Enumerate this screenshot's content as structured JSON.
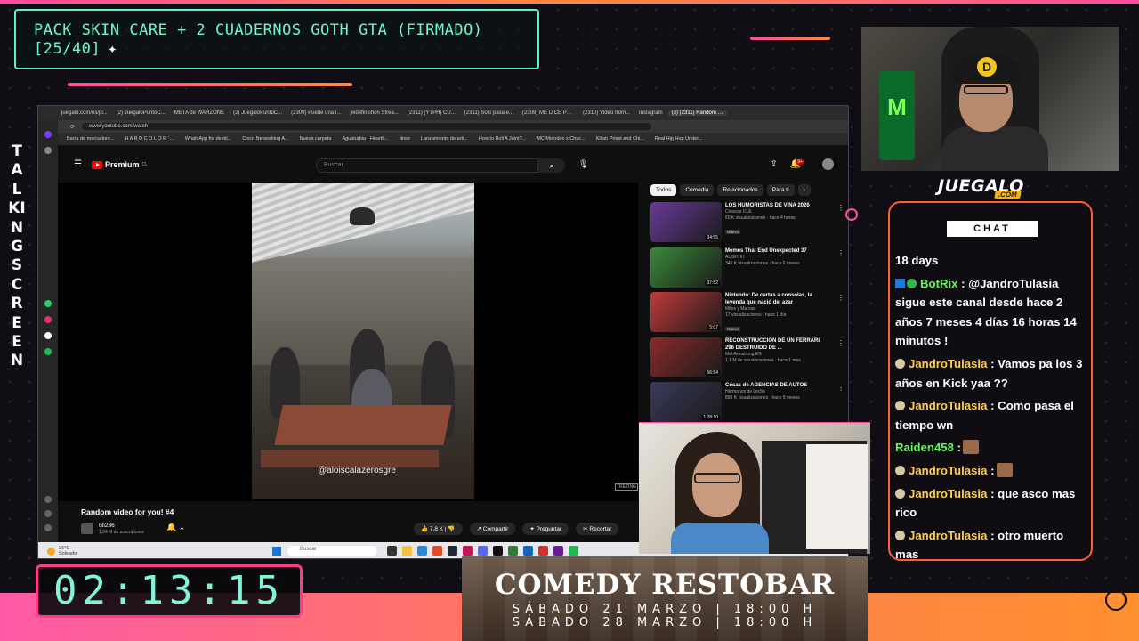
{
  "overlay": {
    "goal_text": "PACK SKIN CARE + 2 CUADERNOS GOTH GTA (FIRMADO)",
    "goal_progress": "[25/40]",
    "goal_spark": "✦",
    "side_text": "TALKING SCREEN",
    "timer": "02:13:15",
    "brand": "JUEGALO",
    "brand_sub": ".COM"
  },
  "browser": {
    "tabs": [
      "juegalo.com/es/pl...",
      "(2) JuegaloPuntoC...",
      "META de WARZONE",
      "(2) JuegaloPuntoC...",
      "(2309) Puede una I...",
      "jeidefinichon Strea...",
      "(2311) (YTPH) CU...",
      "(2311) Solo pasa e...",
      "(2309) ME DICE PR...",
      "(2310) Video from...",
      "Instagram",
      "(3) (2311) Random video"
    ],
    "active_tab_index": 11,
    "url": "www.youtube.com/watch",
    "bookmarks": [
      "Barra de marcadore...",
      "H A R D C O L O R ' ...",
      "WhatsApp for deskt...",
      "Cisco Networking A...",
      "Nueva carpeta",
      "Aguaturbia - Heartb...",
      "drew",
      "Lanzamiento de arti...",
      "How to Roll A Joint?...",
      "MC Melodee x Chuc...",
      "Killah Priest and Chi...",
      "Real Hip Hop Under..."
    ]
  },
  "youtube": {
    "logo": "Premium",
    "logo_region": "CL",
    "search_placeholder": "Buscar",
    "notifications_badge": "9+",
    "video_watermark": "@aloiscalazerosgre",
    "video_tag": "TREZING",
    "video_title": "Random video for you! #4",
    "channel_name": "t3i236",
    "channel_subs": "1,04 M de suscriptores",
    "likes": "7,8 K",
    "share": "Compartir",
    "ask": "Preguntar",
    "clip": "Recortar",
    "chips": [
      "Todos",
      "Comedia",
      "Relacionados",
      "Para ti"
    ],
    "recommendations": [
      {
        "title": "LOS HUMORISTAS DE VIÑA 2026",
        "channel": "Crescas OLE",
        "meta": "50 K visualizaciones · hace 4 horas",
        "badge": "Nuevo",
        "duration": "34:55",
        "color": "#6a3a9a"
      },
      {
        "title": "Memes That End Unexpected 37",
        "channel": "AUGHHH",
        "meta": "340 K visualizaciones · hace 6 meses",
        "badge": "",
        "duration": "37:52",
        "color": "#3a8a3a"
      },
      {
        "title": "Nintendo: De cartas a consolas, la leyenda que nació del azar",
        "channel": "Mitos y Marcas",
        "meta": "17 visualizaciones · hace 1 día",
        "badge": "Nuevo",
        "duration": "5:07",
        "color": "#c23a3a"
      },
      {
        "title": "RECONSTRUCCIÓN DE UN FERRARI 296 DESTRUIDO DE ...",
        "channel": "Mat Armstrong ES",
        "meta": "1,1 M de visualizaciones · hace 1 mes",
        "badge": "",
        "duration": "56:54",
        "color": "#8a2a2a"
      },
      {
        "title": "Cosas de AGENCIAS DE AUTOS",
        "channel": "Hermanos de Leche",
        "meta": "868 K visualizaciones · hace 9 meses",
        "badge": "",
        "duration": "1:28:10",
        "color": "#3a3a5a"
      }
    ]
  },
  "taskbar": {
    "weather_temp": "26°C",
    "weather_label": "Soleado",
    "search": "Buscar"
  },
  "chat": {
    "title": "CHAT",
    "messages": [
      {
        "user": "",
        "text": "18 days"
      },
      {
        "user": "BotRix",
        "text": ": @JandroTulasia sigue este canal desde hace 2 años 7 meses 4 días 16 horas 14 minutos !"
      },
      {
        "user": "JandroTulasia",
        "text": ": Vamos pa los 3 años en Kick yaa ??"
      },
      {
        "user": "JandroTulasia",
        "text": ": Como pasa el tiempo wn"
      },
      {
        "user": "Raiden458",
        "text": ":"
      },
      {
        "user": "JandroTulasia",
        "text": ":"
      },
      {
        "user": "JandroTulasia",
        "text": ": que asco mas rico"
      },
      {
        "user": "JandroTulasia",
        "text": ": otro muerto mas"
      }
    ]
  },
  "ad": {
    "title": "COMEDY RESTOBAR",
    "line1": "SÁBADO 21 MARZO | 18:00 H",
    "line2": "SÁBADO 28 MARZO | 18:00 H"
  },
  "colors": {
    "accent_pink": "#ff4aa0",
    "accent_orange": "#ff8a3a",
    "goal_mint": "#5cf2c8",
    "chat_user": "#ffcf4a",
    "chat_green": "#6af262"
  }
}
